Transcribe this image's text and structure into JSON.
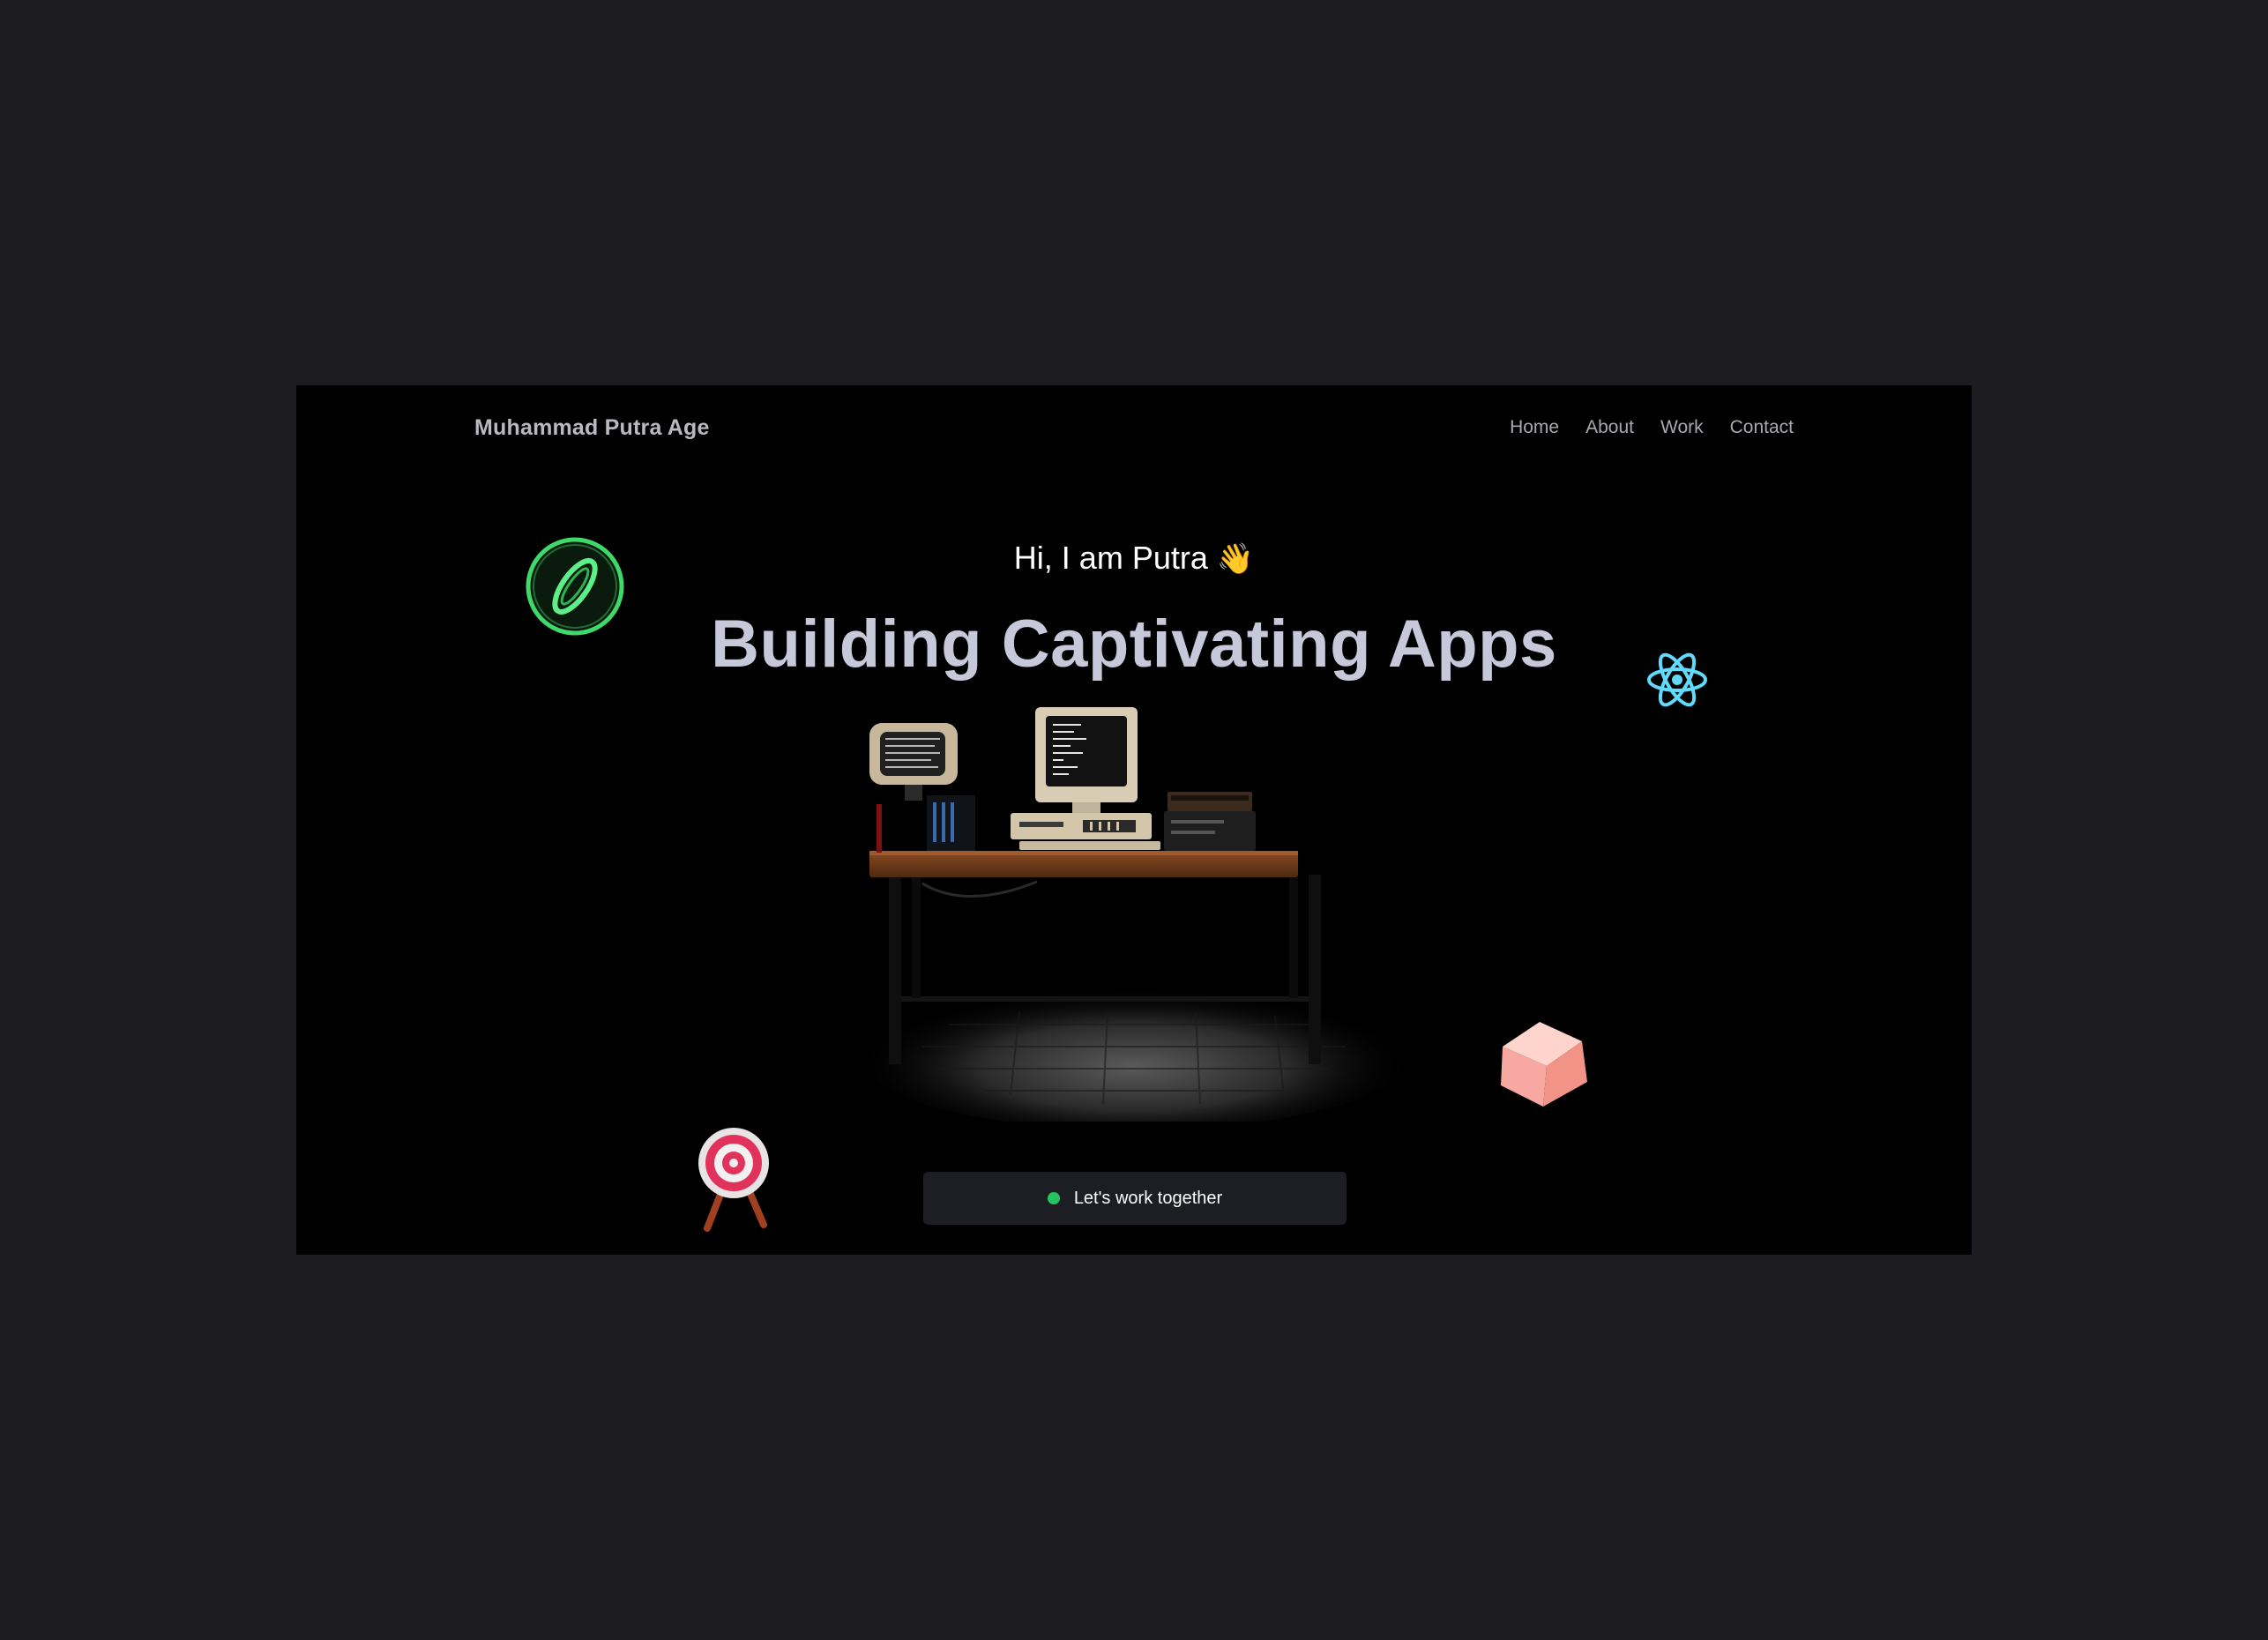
{
  "header": {
    "brand": "Muhammad Putra Age",
    "nav": [
      "Home",
      "About",
      "Work",
      "Contact"
    ]
  },
  "hero": {
    "greeting": "Hi, I am Putra",
    "wave_emoji": "👋",
    "headline": "Building Captivating Apps",
    "cta_label": "Let's work together"
  },
  "decor": {
    "icons": [
      "ring-icon",
      "react-atom-icon",
      "target-icon",
      "cube-icon"
    ],
    "scene": "desk-workstation-illustration"
  },
  "colors": {
    "page_bg": "#1c1c21",
    "frame_bg": "#000000",
    "headline": "#c7c9db",
    "status_dot": "#22c55e",
    "react": "#61dafb",
    "ring": "#3ed96b"
  }
}
